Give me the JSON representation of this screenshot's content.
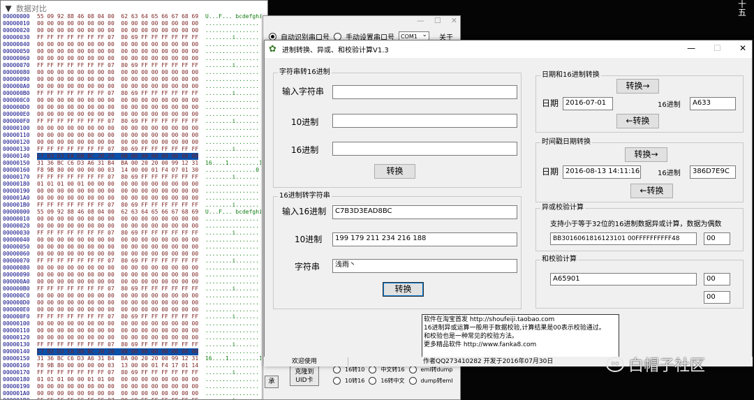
{
  "hex_window": {
    "title": "数据对比",
    "rows": [
      {
        "addr": "00000000",
        "bytes": "55 09 92 88 46 08 04 00  62 63 64 65 66 67 68 69",
        "ascii": "U...F... bcdefghi"
      },
      {
        "addr": "00000010",
        "bytes": "00 00 00 00 00 00 00 00  00 00 00 00 00 00 00 00",
        "ascii": "................"
      },
      {
        "addr": "00000020",
        "bytes": "00 00 00 00 00 00 00 00  00 00 00 00 00 00 00 00",
        "ascii": "................"
      },
      {
        "addr": "00000030",
        "bytes": "FF FF FF FF FF FF FF 07  80 69 FF FF FF FF FF FF",
        "ascii": "........i......."
      },
      {
        "addr": "00000040",
        "bytes": "00 00 00 00 00 00 00 00  00 00 00 00 00 00 00 00",
        "ascii": "................"
      },
      {
        "addr": "00000050",
        "bytes": "00 00 00 00 00 00 00 00  00 00 00 00 00 00 00 00",
        "ascii": "................"
      },
      {
        "addr": "00000060",
        "bytes": "00 00 00 00 00 00 00 00  00 00 00 00 00 00 00 00",
        "ascii": "................"
      },
      {
        "addr": "00000070",
        "bytes": "FF FF FF FF FF FF FF 07  80 69 FF FF FF FF FF FF",
        "ascii": "........i......."
      },
      {
        "addr": "00000080",
        "bytes": "00 00 00 00 00 00 00 00  00 00 00 00 00 00 00 00",
        "ascii": "................"
      },
      {
        "addr": "00000090",
        "bytes": "00 00 00 00 00 00 00 00  00 00 00 00 00 00 00 00",
        "ascii": "................"
      },
      {
        "addr": "000000A0",
        "bytes": "00 00 00 00 00 00 00 00  00 00 00 00 00 00 00 00",
        "ascii": "................"
      },
      {
        "addr": "000000B0",
        "bytes": "FF FF FF FF FF FF FF 07  80 69 FF FF FF FF FF FF",
        "ascii": "........i......."
      },
      {
        "addr": "000000C0",
        "bytes": "00 00 00 00 00 00 00 00  00 00 00 00 00 00 00 00",
        "ascii": "................"
      },
      {
        "addr": "000000D0",
        "bytes": "00 00 00 00 00 00 00 00  00 00 00 00 00 00 00 00",
        "ascii": "................"
      },
      {
        "addr": "000000E0",
        "bytes": "00 00 00 00 00 00 00 00  00 00 00 00 00 00 00 00",
        "ascii": "................"
      },
      {
        "addr": "000000F0",
        "bytes": "FF FF FF FF FF FF FF 07  80 69 FF FF FF FF FF FF",
        "ascii": "........i......."
      },
      {
        "addr": "00000100",
        "bytes": "00 00 00 00 00 00 00 00  00 00 00 00 00 00 00 00",
        "ascii": "................"
      },
      {
        "addr": "00000110",
        "bytes": "00 00 00 00 00 00 00 00  00 00 00 00 00 00 00 00",
        "ascii": "................"
      },
      {
        "addr": "00000120",
        "bytes": "00 00 00 00 00 00 00 00  00 00 00 00 00 00 00 00",
        "ascii": "................"
      },
      {
        "addr": "00000130",
        "bytes": "FF FF FF FF FF FF FF 07  80 69 FF FF FF FF FF FF",
        "ascii": "........i......."
      },
      {
        "addr": "00000140",
        "bytes": "C7 B3 D3 EA D8 BC 20 20  00 00 00 00 00 00 00 00",
        "ascii": "................"
      },
      {
        "addr": "00000150",
        "bytes": "31 36 BC C6 D3 A6 31 B4  BA 00 20 20 00 99 12 31",
        "ascii": "16....1.........1"
      },
      {
        "addr": "00000160",
        "bytes": "F8 9B 80 00 00 00 00 03  14 00 00 01 F4 07 01 30",
        "ascii": "...............0"
      },
      {
        "addr": "00000170",
        "bytes": "FF FF FF FF FF FF FF 07  80 69 FF FF FF FF FF FF",
        "ascii": "........i......."
      },
      {
        "addr": "00000180",
        "bytes": "01 01 01 00 01 00 00 00  00 00 00 00 00 00 00 00",
        "ascii": "................"
      },
      {
        "addr": "00000190",
        "bytes": "00 00 00 00 00 00 00 00  00 00 00 00 00 00 00 00",
        "ascii": "................"
      },
      {
        "addr": "000001A0",
        "bytes": "00 00 00 00 00 00 00 00  00 00 00 00 00 00 00 00",
        "ascii": "................"
      },
      {
        "addr": "000001B0",
        "bytes": "FF FF FF FF FF FF FF 07  80 69 FF FF FF FF FF FF",
        "ascii": "........i......."
      },
      {
        "addr": "00000000",
        "bytes": "55 09 92 88 46 08 04 00  62 63 64 65 66 67 68 69",
        "ascii": "U...F... bcdefghi"
      },
      {
        "addr": "00000010",
        "bytes": "00 00 00 00 00 00 00 00  00 00 00 00 00 00 00 00",
        "ascii": "................"
      },
      {
        "addr": "00000020",
        "bytes": "00 00 00 00 00 00 00 00  00 00 00 00 00 00 00 00",
        "ascii": "................"
      },
      {
        "addr": "00000030",
        "bytes": "FF FF FF FF FF FF FF 07  80 69 FF FF FF FF FF FF",
        "ascii": "........i......."
      },
      {
        "addr": "00000040",
        "bytes": "00 00 00 00 00 00 00 00  00 00 00 00 00 00 00 00",
        "ascii": "................"
      },
      {
        "addr": "00000050",
        "bytes": "00 00 00 00 00 00 00 00  00 00 00 00 00 00 00 00",
        "ascii": "................"
      },
      {
        "addr": "00000060",
        "bytes": "00 00 00 00 00 00 00 00  00 00 00 00 00 00 00 00",
        "ascii": "................"
      },
      {
        "addr": "00000070",
        "bytes": "FF FF FF FF FF FF FF 07  80 69 FF FF FF FF FF FF",
        "ascii": "........i......."
      },
      {
        "addr": "00000080",
        "bytes": "00 00 00 00 00 00 00 00  00 00 00 00 00 00 00 00",
        "ascii": "................"
      },
      {
        "addr": "00000090",
        "bytes": "00 00 00 00 00 00 00 00  00 00 00 00 00 00 00 00",
        "ascii": "................"
      },
      {
        "addr": "000000A0",
        "bytes": "00 00 00 00 00 00 00 00  00 00 00 00 00 00 00 00",
        "ascii": "................"
      },
      {
        "addr": "000000B0",
        "bytes": "FF FF FF FF FF FF FF 07  80 69 FF FF FF FF FF FF",
        "ascii": "........i......."
      },
      {
        "addr": "000000C0",
        "bytes": "00 00 00 00 00 00 00 00  00 00 00 00 00 00 00 00",
        "ascii": "................"
      },
      {
        "addr": "000000D0",
        "bytes": "00 00 00 00 00 00 00 00  00 00 00 00 00 00 00 00",
        "ascii": "................"
      },
      {
        "addr": "000000E0",
        "bytes": "00 00 00 00 00 00 00 00  00 00 00 00 00 00 00 00",
        "ascii": "................"
      },
      {
        "addr": "000000F0",
        "bytes": "FF FF FF FF FF FF FF 07  80 69 FF FF FF FF FF FF",
        "ascii": "........i......."
      },
      {
        "addr": "00000100",
        "bytes": "00 00 00 00 00 00 00 00  00 00 00 00 00 00 00 00",
        "ascii": "................"
      },
      {
        "addr": "00000110",
        "bytes": "00 00 00 00 00 00 00 00  00 00 00 00 00 00 00 00",
        "ascii": "................"
      },
      {
        "addr": "00000120",
        "bytes": "00 00 00 00 00 00 00 00  00 00 00 00 00 00 00 00",
        "ascii": "................"
      },
      {
        "addr": "00000130",
        "bytes": "FF FF FF FF FF FF FF 07  80 69 FF FF FF FF FF FF",
        "ascii": "........i......."
      },
      {
        "addr": "00000140",
        "bytes": "C7 B3 D3 EA D8 BC 20 20  00 00 00 00 00 00 00 00",
        "ascii": "................"
      },
      {
        "addr": "00000150",
        "bytes": "31 36 BC C6 D3 A6 31 B4  BA 00 20 20 00 99 12 31",
        "ascii": "16....1.........1"
      },
      {
        "addr": "00000160",
        "bytes": "F8 9B 80 00 00 00 00 03  13 00 00 01 F4 17 01 14",
        "ascii": "................"
      },
      {
        "addr": "00000170",
        "bytes": "FF FF FF FF FF FF FF 07  80 69 FF FF FF FF FF FF",
        "ascii": "........i......."
      },
      {
        "addr": "00000180",
        "bytes": "01 01 01 00 00 01 01 00  00 00 00 00 00 00 00 00",
        "ascii": "................"
      },
      {
        "addr": "00000190",
        "bytes": "00 00 00 00 00 00 00 00  00 00 00 00 00 00 00 00",
        "ascii": "................"
      },
      {
        "addr": "000001A0",
        "bytes": "00 00 00 00 00 00 00 00  00 00 00 00 00 00 00 00",
        "ascii": "................"
      },
      {
        "addr": "000001B0",
        "bytes": "FF FF FF FF FF FF FF 07  80 69 FF FF FF FF FF FF",
        "ascii": "........i......."
      }
    ]
  },
  "serial_window": {
    "radio_auto": "自动识别串口号",
    "radio_manual": "手动设置串口号",
    "port_value": "COM1",
    "about": "关于",
    "clone_button": "克隆到\nUID卡",
    "left_button": "承",
    "options": [
      [
        "16转10",
        "中文转16",
        "eml转dump"
      ],
      [
        "10转16",
        "16转中文",
        "dump转eml"
      ]
    ]
  },
  "calc_window": {
    "title": "进制转换、异或、和校验计算V1.3",
    "str2hex": {
      "group_title": "字符串转16进制",
      "input_label": "输入字符串",
      "input_value": "",
      "dec_label": "10进制",
      "dec_value": "",
      "hex_label": "16进制",
      "hex_value": "",
      "button": "转换"
    },
    "hex2str": {
      "group_title": "16进制转字符串",
      "input_label": "输入16进制",
      "input_value": "C7B3D3EAD8BC",
      "dec_label": "10进制",
      "dec_value": "199 179 211 234 216 188",
      "str_label": "字符串",
      "str_value": "浅雨丶",
      "button": "转换"
    },
    "date2hex": {
      "group_title": "日期和16进制转换",
      "btn_forward": "转换→",
      "btn_back": "←转换",
      "date_label": "日期",
      "date_value": "2016-07-01",
      "hex_label": "16进制",
      "hex_value": "A633"
    },
    "timestamp": {
      "group_title": "时间戳日期转换",
      "btn_forward": "转换→",
      "btn_back": "←转换",
      "date_label": "日期",
      "date_value": "2016-08-13 14:11:16",
      "hex_label": "16进制",
      "hex_value": "386D7E9C"
    },
    "xor": {
      "group_title": "异或校验计算",
      "hint": "支持小于等于32位的16进制数据异或计算，数据为偶数",
      "input_value": "BB3016061816123101 00FFFFFFFFFF48",
      "result": "00"
    },
    "sum": {
      "group_title": "和校验计算",
      "input_value": "A65901",
      "result1": "00",
      "result2": "00"
    },
    "info_lines": [
      "软件在淘宝首发  http://shoufeiji.taobao.com",
      "16进制异或运算一般用于数据校验,计算结果是00表示校验通过。",
      "和校验也是一种常见的校验方法。",
      "更多精品软件  http://www.fanka8.com"
    ],
    "status_left": "欢迎使用",
    "status_right": "作者QQ273410282 开发于2016年07月30日"
  },
  "desktop": {
    "corner_chars": "十\n五",
    "watermark": "白帽子社区"
  }
}
